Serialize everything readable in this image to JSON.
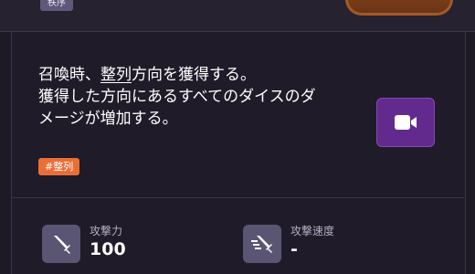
{
  "top": {
    "chip": "秩序"
  },
  "description": {
    "line1_before": "召喚時、",
    "line1_keyword": "整列",
    "line1_after": "方向を獲得する。",
    "line2": "獲得した方向にあるすべてのダイスのダ",
    "line3": "メージが増加する。"
  },
  "video_button": {
    "icon": "video-camera-icon"
  },
  "tag": {
    "label": "#整列",
    "color": "#e96f37"
  },
  "stats": [
    {
      "label": "攻撃力",
      "value": "100",
      "icon": "sword-icon"
    },
    {
      "label": "攻撃速度",
      "value": "-",
      "icon": "sword-speed-icon"
    }
  ],
  "colors": {
    "accent": "#632a8e",
    "background": "#1f1b28"
  }
}
